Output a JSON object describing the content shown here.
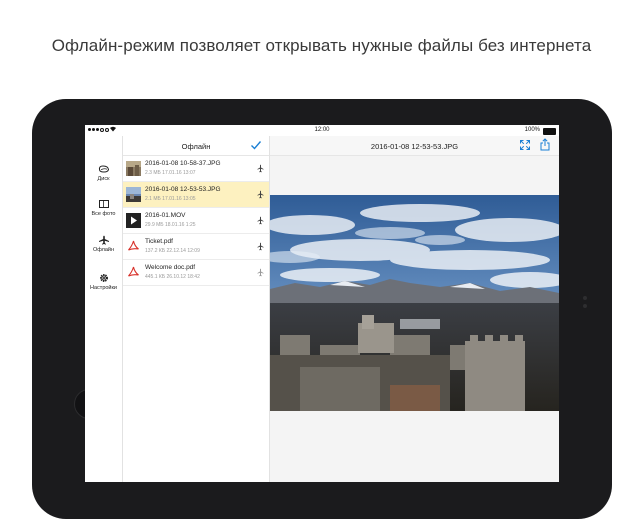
{
  "headline": "Офлайн-режим позволяет открывать нужные файлы без интернета",
  "status_bar": {
    "time": "12:00",
    "battery": "100%"
  },
  "sidebar": {
    "items": [
      {
        "label": "Диск",
        "icon": "disk-icon"
      },
      {
        "label": "Все фото",
        "icon": "photos-icon"
      },
      {
        "label": "Офлайн",
        "icon": "airplane-icon"
      },
      {
        "label": "Настройки",
        "icon": "gear-icon"
      }
    ]
  },
  "file_panel": {
    "title": "Офлайн",
    "done_icon": "checkmark-icon",
    "files": [
      {
        "name": "2016-01-08 10-58-37.JPG",
        "meta": "2.3 МБ  17.01.16 13:07",
        "type": "image",
        "selected": false
      },
      {
        "name": "2016-01-08 12-53-53.JPG",
        "meta": "2.1 МБ  17.01.16 13:05",
        "type": "image",
        "selected": true
      },
      {
        "name": "2016-01.MOV",
        "meta": "29.9 МБ  18.01.16 1:25",
        "type": "video",
        "selected": false
      },
      {
        "name": "Ticket.pdf",
        "meta": "137.2 КБ  22.12.14 12:09",
        "type": "pdf",
        "selected": false
      },
      {
        "name": "Welcome doc.pdf",
        "meta": "445.1 КБ  26.10.12 18:42",
        "type": "pdf",
        "selected": false
      }
    ]
  },
  "viewer": {
    "title": "2016-01-08 12-53-53.JPG",
    "expand_icon": "expand-icon",
    "share_icon": "share-icon"
  },
  "colors": {
    "accent": "#1a7fd4",
    "selected_row": "#fdf1c0",
    "device": "#1b1b1d",
    "pdf_red": "#d8312a"
  }
}
